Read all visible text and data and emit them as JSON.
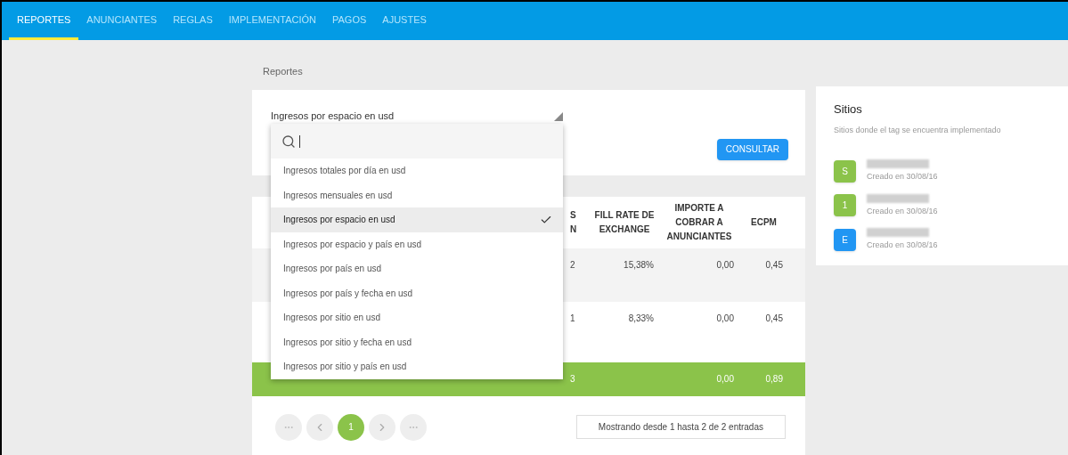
{
  "nav": {
    "tabs": [
      {
        "label": "REPORTES",
        "selected": true
      },
      {
        "label": "ANUNCIANTES",
        "selected": false
      },
      {
        "label": "REGLAS",
        "selected": false
      },
      {
        "label": "IMPLEMENTACIÓN",
        "selected": false
      },
      {
        "label": "PAGOS",
        "selected": false
      },
      {
        "label": "AJUSTES",
        "selected": false
      }
    ]
  },
  "breadcrumb": "Reportes",
  "report_select": {
    "value": "Ingresos por espacio en usd",
    "expanded": true,
    "options": [
      {
        "label": "Ingresos totales por día en usd",
        "selected": false
      },
      {
        "label": "Ingresos mensuales en usd",
        "selected": false
      },
      {
        "label": "Ingresos por espacio en usd",
        "selected": true
      },
      {
        "label": "Ingresos por espacio y país en usd",
        "selected": false
      },
      {
        "label": "Ingresos por país en usd",
        "selected": false
      },
      {
        "label": "Ingresos por país y fecha en usd",
        "selected": false
      },
      {
        "label": "Ingresos por sitio en usd",
        "selected": false
      },
      {
        "label": "Ingresos por sitio y fecha en usd",
        "selected": false
      },
      {
        "label": "Ingresos por sitio y país en usd",
        "selected": false
      }
    ]
  },
  "consult_button": "CONSULTAR",
  "table": {
    "columns": [
      "S N",
      "FILL RATE DE EXCHANGE",
      "IMPORTE A COBRAR A ANUNCIANTES",
      "ECPM"
    ],
    "rows": [
      {
        "cells": [
          "2",
          "15,38%",
          "0,00",
          "0,45"
        ]
      },
      {
        "cells": [
          "1",
          "8,33%",
          "0,00",
          "0,45"
        ]
      }
    ],
    "total": {
      "count": "3",
      "amount": "0,00",
      "ecpm": "0,89"
    }
  },
  "pagination": {
    "pages": [
      {
        "label": "1",
        "selected": true
      }
    ]
  },
  "entries_info": "Mostrando desde 1 hasta 2 de 2 entradas",
  "sites": {
    "title": "Sitios",
    "subtitle": "Sitios donde el tag se encuentra implementado",
    "items": [
      {
        "letter": "S",
        "color": "#8bc34a",
        "created": "Creado en 30/08/16"
      },
      {
        "letter": "1",
        "color": "#8bc34a",
        "created": "Creado en 30/08/16"
      },
      {
        "letter": "E",
        "color": "#2196f3",
        "created": "Creado en 30/08/16"
      }
    ]
  }
}
